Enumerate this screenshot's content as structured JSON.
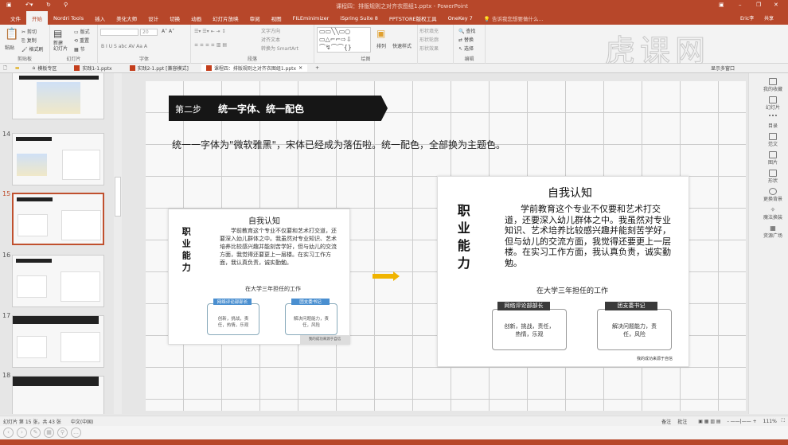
{
  "window": {
    "title": "课程四：排版规则之对齐衣图组1.pptx - PowerPoint",
    "quick_access": [
      "save-icon",
      "undo-icon",
      "redo-icon",
      "customize-icon"
    ]
  },
  "ribbon_tabs": [
    "文件",
    "开始",
    "Nordri Tools",
    "插入",
    "美化大师",
    "设计",
    "切换",
    "动画",
    "幻灯片放映",
    "审阅",
    "视图",
    "FILEminimizer",
    "iSpring Suite 8",
    "PPTSTORE版权工具",
    "OneKey 7"
  ],
  "active_tab": "开始",
  "tell_me": "告诉我您想要做什么...",
  "user": "Eric李",
  "share": "共享",
  "watermark": "虎课网",
  "ribbon": {
    "clipboard": {
      "label": "剪贴板",
      "paste": "粘贴",
      "cut": "剪切",
      "copy": "复制",
      "format_painter": "格式刷"
    },
    "slides": {
      "label": "幻灯片",
      "new_slide": "新建\n幻灯片",
      "layout": "版式",
      "reset": "重置",
      "section": "节"
    },
    "font": {
      "label": "字体",
      "size": "20"
    },
    "paragraph": {
      "label": "段落",
      "text_direction": "文字方向",
      "align_text": "对齐文本",
      "smartart": "转换为 SmartArt"
    },
    "drawing": {
      "label": "绘图",
      "arrange": "排列",
      "quick_styles": "快速样式",
      "fill": "形状填充",
      "outline": "形状轮廓",
      "effects": "形状效果"
    },
    "editing": {
      "label": "编辑",
      "find": "查找",
      "replace": "替换",
      "select": "选择"
    }
  },
  "doc_tabs": [
    {
      "label": "模板专区"
    },
    {
      "label": "实践1-1.pptx"
    },
    {
      "label": "实践2-1.ppt [兼容模式]"
    },
    {
      "label": "课程四：排版规则之对齐衣图组1.pptx",
      "active": true
    }
  ],
  "show_multi_window": "显示多窗口",
  "thumbnails": [
    {
      "num": "13"
    },
    {
      "num": "14"
    },
    {
      "num": "15",
      "selected": true
    },
    {
      "num": "16"
    },
    {
      "num": "17"
    },
    {
      "num": "18"
    }
  ],
  "slide": {
    "step": "第二步",
    "step_title": "统一字体、统一配色",
    "instruction": "统一一字体为\"微软雅黑\"，宋体已经成为落伍啦。统一配色，全部换为主题色。",
    "left_card": {
      "vertical": "职业能力",
      "title": "自我认知",
      "body": "学前教育这个专业不仅要和艺术打交道，还要深入幼儿群体之中。我虽然对专业知识、艺术培养比较感兴趣并能刻苦学好，但与幼儿的交流方面，我觉得还要更上一层楼。在实习工作方面，我认真负责，诚实勤勉。",
      "subtitle": "在大学三年担任的工作",
      "role1": "网络评论部部长",
      "role1_text": "创新，挑战，责任，热情，乐观",
      "role2": "团支委书记",
      "role2_text": "解决问题能力，责任，风险",
      "footer": "我的成功来源于自信"
    },
    "right_card": {
      "vertical": "职业能力",
      "title": "自我认知",
      "body": "学前教育这个专业不仅要和艺术打交道，还要深入幼儿群体之中。我虽然对专业知识、艺术培养比较感兴趣并能刻苦学好，但与幼儿的交流方面，我觉得还要更上一层楼。在实习工作方面，我认真负责，诚实勤勉。",
      "subtitle": "在大学三年担任的工作",
      "role1": "网络评论部部长",
      "role1_text": "创新，挑战，责任，热情，乐观",
      "role2": "团支委书记",
      "role2_text": "解决问题能力，责任，风险",
      "footer": "我的成功来源于自信"
    },
    "colors": {
      "left_label": "#4a8fd0",
      "right_label": "#3a3a3a",
      "arrow": "#f0b400"
    }
  },
  "right_panel": [
    "我的收藏",
    "幻灯片",
    "目录",
    "范文",
    "图片",
    "形状",
    "更换背景",
    "魔法换装",
    "资源广场"
  ],
  "status": {
    "slide_info": "幻灯片 第 15 张，共 43 张",
    "language": "中文(中国)",
    "notes": "备注",
    "comments": "批注",
    "zoom": "111%"
  },
  "colors": {
    "accent": "#b7472a"
  }
}
